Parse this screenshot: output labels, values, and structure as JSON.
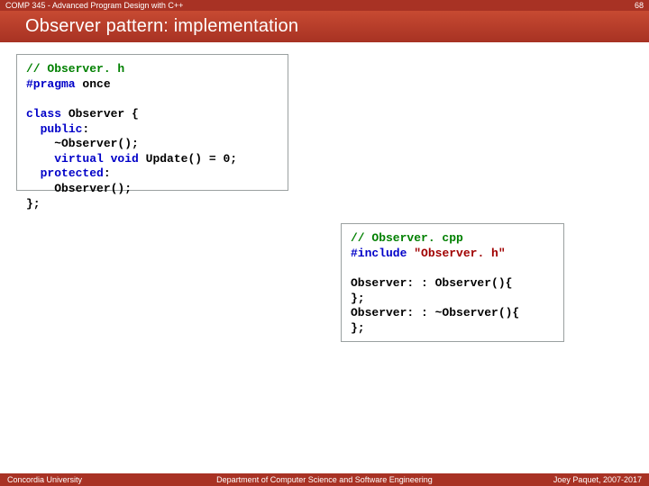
{
  "header": {
    "course": "COMP 345 - Advanced Program Design with C++",
    "slide_number": "68"
  },
  "title": "Observer pattern: implementation",
  "code_h": {
    "l1": {
      "a": "// Observer. h"
    },
    "l2": {
      "a": "#pragma",
      "b": " once"
    },
    "l3": "",
    "l4": {
      "a": "class",
      "b": " Observer {"
    },
    "l5": {
      "a": "  ",
      "b": "public",
      "c": ":"
    },
    "l6": {
      "a": "    ~Observer();"
    },
    "l7": {
      "a": "    ",
      "b": "virtual void",
      "c": " Update() = 0;"
    },
    "l8": {
      "a": "  ",
      "b": "protected",
      "c": ":"
    },
    "l9": {
      "a": "    Observer();"
    },
    "l10": {
      "a": "};"
    }
  },
  "code_cpp": {
    "l1": {
      "a": "// Observer. cpp"
    },
    "l2": {
      "a": "#include",
      "b": " ",
      "c": "\"Observer. h\""
    },
    "l3": "",
    "l4": {
      "a": "Observer: : Observer(){"
    },
    "l5": {
      "a": "};"
    },
    "l6": {
      "a": "Observer: : ~Observer(){"
    },
    "l7": {
      "a": "};"
    }
  },
  "footer": {
    "left": "Concordia University",
    "center": "Department of Computer Science and Software Engineering",
    "right": "Joey Paquet, 2007-2017"
  }
}
